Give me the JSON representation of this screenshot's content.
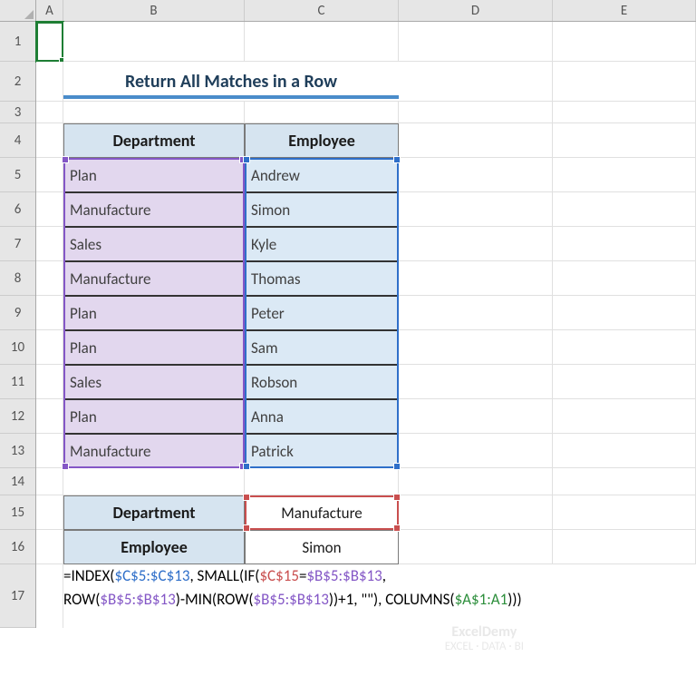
{
  "columns": [
    "A",
    "B",
    "C",
    "D",
    "E"
  ],
  "rows": [
    "1",
    "2",
    "3",
    "4",
    "5",
    "6",
    "7",
    "8",
    "9",
    "10",
    "11",
    "12",
    "13",
    "14",
    "15",
    "16",
    "17"
  ],
  "title": "Return All Matches in a Row",
  "table": {
    "headers": {
      "dept": "Department",
      "emp": "Employee"
    },
    "rows": [
      {
        "dept": "Plan",
        "emp": "Andrew"
      },
      {
        "dept": "Manufacture",
        "emp": "Simon"
      },
      {
        "dept": "Sales",
        "emp": "Kyle"
      },
      {
        "dept": "Manufacture",
        "emp": "Thomas"
      },
      {
        "dept": "Plan",
        "emp": "Peter"
      },
      {
        "dept": "Plan",
        "emp": "Sam"
      },
      {
        "dept": "Sales",
        "emp": "Robson"
      },
      {
        "dept": "Plan",
        "emp": "Anna"
      },
      {
        "dept": "Manufacture",
        "emp": "Patrick"
      }
    ]
  },
  "lookup": {
    "dept_label": "Department",
    "dept_value": "Manufacture",
    "emp_label": "Employee",
    "emp_value": "Simon"
  },
  "formula": {
    "p1": "=INDEX(",
    "r1": "$C$5:$C$13",
    "p2": ", SMALL(IF(",
    "r2": "$C$15",
    "p3": "=",
    "r3": "$B$5:$B$13",
    "p4": ", ",
    "p5": "ROW(",
    "r4": "$B$5:$B$13",
    "p6": ")-MIN(ROW(",
    "r5": "$B$5:$B$13",
    "p7": "))+1, \"\"), COLUMNS(",
    "r6": "$A$1:A1",
    "p8": ")))"
  },
  "watermark": {
    "l1": "ExcelDemy",
    "l2": "EXCEL · DATA · BI"
  }
}
